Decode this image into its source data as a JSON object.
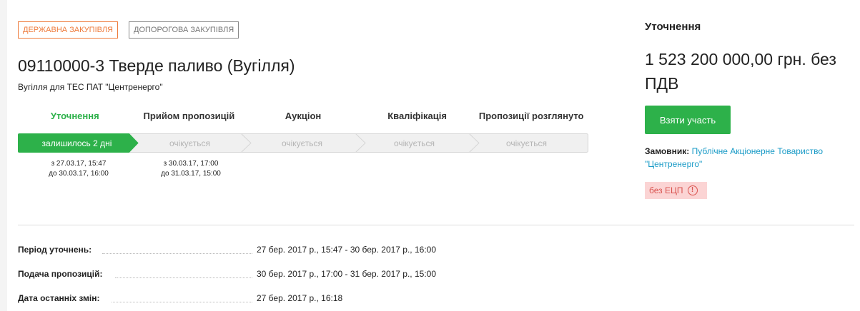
{
  "tags": {
    "gov": "ДЕРЖАВНА ЗАКУПІВЛЯ",
    "below": "ДОПОРОГОВА ЗАКУПІВЛЯ"
  },
  "tender": {
    "title": "09110000-3 Тверде паливо (Вугілля)",
    "subtitle": "Вугілля для ТЕС ПАТ \"Центренерго\""
  },
  "stages": [
    {
      "label": "Уточнення",
      "status": "залишилось 2 дні",
      "from": "з 27.03.17, 15:47",
      "to": "до 30.03.17, 16:00"
    },
    {
      "label": "Прийом пропозицій",
      "status": "очікується",
      "from": "з 30.03.17, 17:00",
      "to": "до 31.03.17, 15:00"
    },
    {
      "label": "Аукціон",
      "status": "очікується"
    },
    {
      "label": "Кваліфікація",
      "status": "очікується"
    },
    {
      "label": "Пропозиції розглянуто",
      "status": "очікується"
    }
  ],
  "details": [
    {
      "label": "Період уточнень:",
      "value": "27 бер. 2017 р., 15:47 - 30 бер. 2017 р., 16:00"
    },
    {
      "label": "Подача пропозицій:",
      "value": "30 бер. 2017 р., 17:00 - 31 бер. 2017 р., 15:00"
    },
    {
      "label": "Дата останніх змін:",
      "value": "27 бер. 2017 р., 16:18"
    }
  ],
  "side": {
    "status_title": "Уточнення",
    "price": "1 523 200 000,00 грн. без ПДВ",
    "join_button": "Взяти участь",
    "customer_label": "Замовник:",
    "customer_name": "Публічне Акціонерне Товариство \"Центренерго\"",
    "signature_badge": "без ЕЦП",
    "warning_glyph": "!"
  },
  "colors": {
    "accent": "#2db14a",
    "orange": "#ee7b3c",
    "link": "#1a9bc7",
    "badge_bg": "#fbd4d4",
    "badge_text": "#d9534f"
  }
}
